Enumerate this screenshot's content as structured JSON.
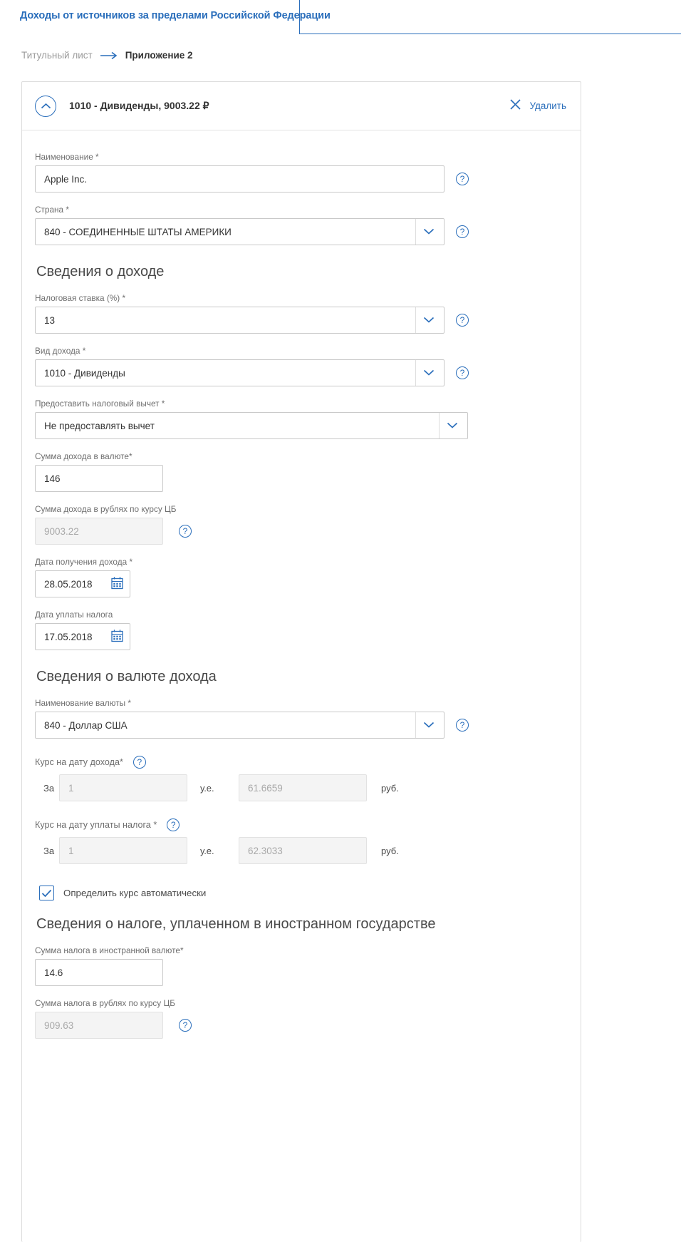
{
  "header": {
    "app_title": "Доходы от источников за пределами Российской Федерации"
  },
  "breadcrumb": {
    "previous": "Титульный лист",
    "current": "Приложение 2"
  },
  "card": {
    "title": "1010 - Дивиденды, 9003.22 ₽",
    "delete_label": "Удалить",
    "collapse_icon": "chevron-up-icon",
    "close_icon": "close-icon"
  },
  "fields": {
    "name": {
      "label": "Наименование *",
      "value": "Apple Inc."
    },
    "country": {
      "label": "Страна *",
      "value": "840 - СОЕДИНЕННЫЕ ШТАТЫ АМЕРИКИ"
    }
  },
  "income_section": {
    "title": "Сведения о доходе",
    "tax_rate": {
      "label": "Налоговая ставка (%) *",
      "value": "13"
    },
    "income_type": {
      "label": "Вид дохода *",
      "value": "1010 - Дивиденды"
    },
    "deduction": {
      "label": "Предоставить налоговый вычет *",
      "value": "Не предоставлять вычет"
    },
    "amount_currency": {
      "label": "Сумма дохода в валюте*",
      "value": "146"
    },
    "amount_rubles": {
      "label": "Сумма дохода в рублях по курсу ЦБ",
      "value": "9003.22"
    },
    "date_income": {
      "label": "Дата получения дохода *",
      "value": "28.05.2018"
    },
    "date_tax_payment": {
      "label": "Дата уплаты налога",
      "value": "17.05.2018"
    }
  },
  "currency_section": {
    "title": "Сведения о валюте дохода",
    "currency_name": {
      "label": "Наименование валюты *",
      "value": "840 - Доллар США"
    },
    "rate_income_date": {
      "label": "Курс на дату дохода*",
      "prefix": "За",
      "units": "1",
      "unit_label": "у.е.",
      "rate": "61.6659",
      "rate_label": "руб."
    },
    "rate_tax_date": {
      "label": "Курс на дату уплаты налога *",
      "prefix": "За",
      "units": "1",
      "unit_label": "у.е.",
      "rate": "62.3033",
      "rate_label": "руб."
    },
    "auto_rate": {
      "label": "Определить курс автоматически",
      "checked": true
    }
  },
  "foreign_tax_section": {
    "title": "Сведения о налоге, уплаченном в иностранном государстве",
    "tax_currency": {
      "label": "Сумма налога в иностранной валюте*",
      "value": "14.6"
    },
    "tax_rubles": {
      "label": "Сумма налога в рублях по курсу ЦБ",
      "value": "909.63"
    }
  },
  "colors": {
    "accent": "#2a6ebb",
    "text": "#333333",
    "label": "#6e6e6e",
    "disabled_bg": "#f4f4f4"
  }
}
